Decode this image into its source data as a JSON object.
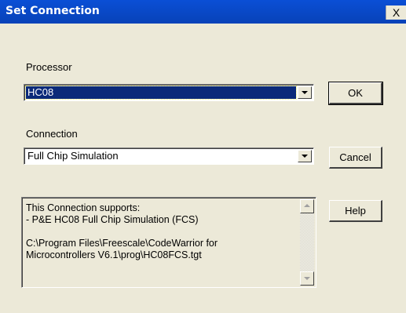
{
  "window": {
    "title": "Set Connection",
    "close_glyph": "X"
  },
  "processor": {
    "label": "Processor",
    "selected": "HC08"
  },
  "connection": {
    "label": "Connection",
    "selected": "Full Chip Simulation"
  },
  "buttons": {
    "ok": "OK",
    "cancel": "Cancel",
    "help": "Help"
  },
  "info": {
    "text": "This Connection supports:\n- P&E HC08 Full Chip Simulation (FCS)\n\nC:\\Program Files\\Freescale\\CodeWarrior for\nMicrocontrollers V6.1\\prog\\HC08FCS.tgt"
  },
  "icons": {
    "dropdown": "chevron-down-icon",
    "scroll_up": "arrow-up-icon",
    "scroll_down": "arrow-down-icon",
    "close": "close-icon"
  }
}
